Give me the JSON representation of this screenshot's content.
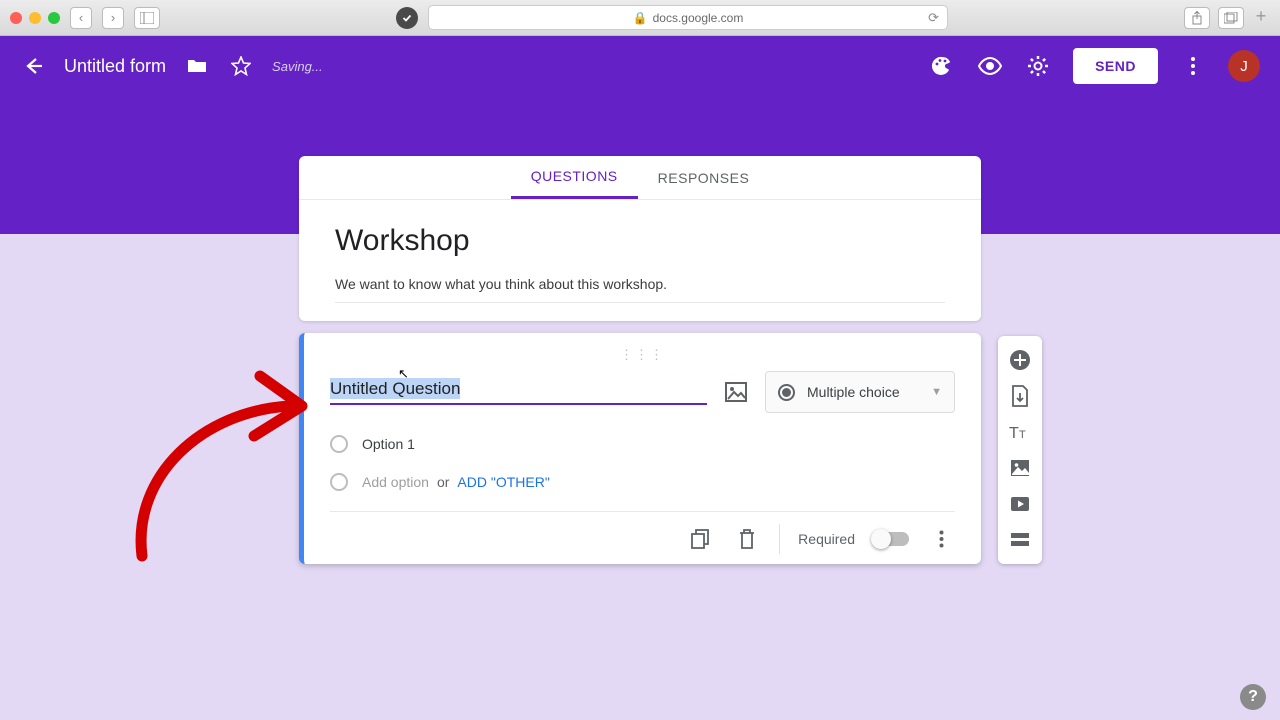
{
  "browser": {
    "url_host": "docs.google.com"
  },
  "appbar": {
    "doc_title": "Untitled form",
    "saving": "Saving...",
    "send_label": "SEND",
    "avatar_initial": "J"
  },
  "tabs": {
    "questions": "QUESTIONS",
    "responses": "RESPONSES"
  },
  "form": {
    "title": "Workshop",
    "description": "We want to know what you think about this workshop."
  },
  "question": {
    "title": "Untitled Question",
    "type_label": "Multiple choice",
    "option1": "Option 1",
    "add_option": "Add option",
    "or": "or",
    "add_other": "ADD \"OTHER\"",
    "required_label": "Required"
  }
}
